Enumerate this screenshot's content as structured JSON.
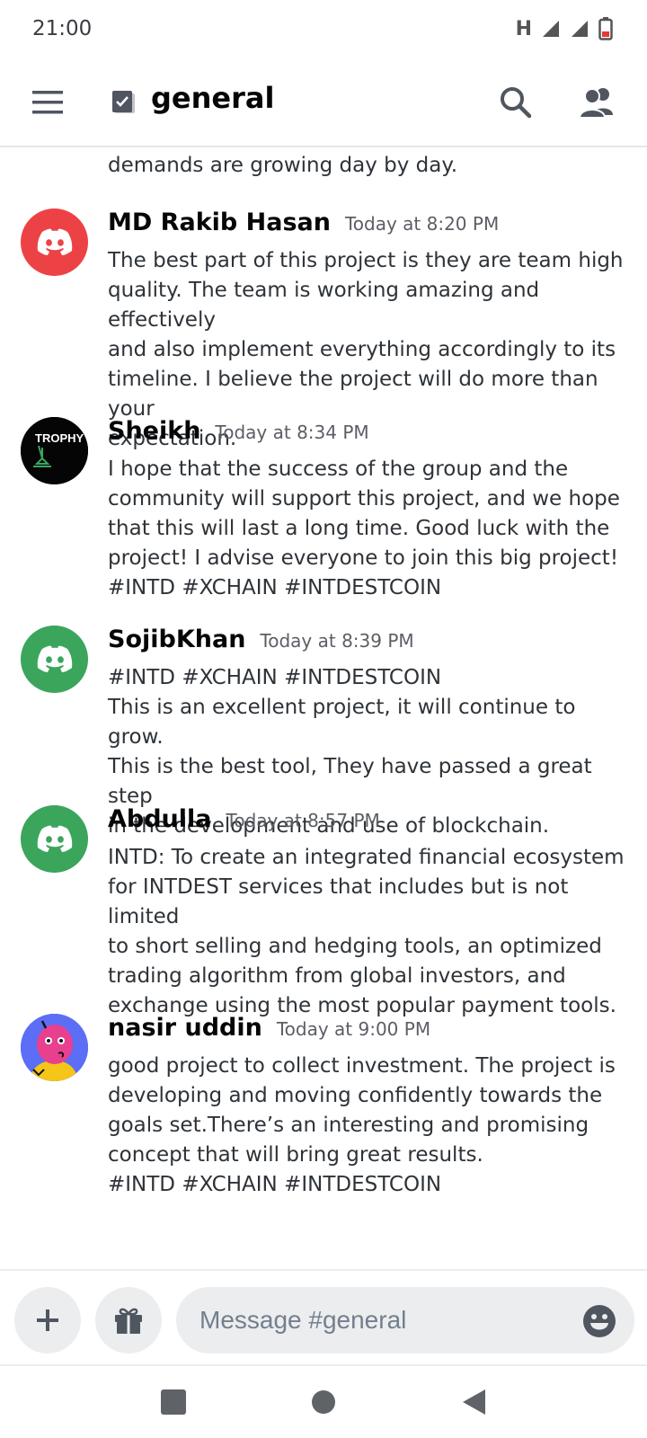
{
  "status_bar": {
    "time": "21:00",
    "network_type": "H"
  },
  "header": {
    "channel_name": "general",
    "icons": [
      "menu-icon",
      "channel-icon",
      "search-icon",
      "members-icon"
    ]
  },
  "messages": {
    "partial_text": "demands are growing day by day.",
    "items": [
      {
        "username": "MD Rakib Hasan",
        "timestamp": "Today at 8:20 PM",
        "avatar": "discord-default-red",
        "avatar_color": "#ed4245",
        "lines": [
          "The best part of this project is they are team high",
          "quality. The team is working amazing and effectively",
          "and also implement everything accordingly to its",
          "timeline. I believe the project will do more than your",
          "expectation."
        ]
      },
      {
        "username": "Sheikh",
        "timestamp": "Today at 8:34 PM",
        "avatar": "trophy-avatar",
        "avatar_text": "TROPHY",
        "lines": [
          "I hope that the success of the group and the",
          "community will support this project, and we hope",
          "that this will last a long time. Good luck with the",
          "project! I advise everyone to join this big project!",
          "#INTD #XCHAIN  #INTDESTCOIN"
        ]
      },
      {
        "username": "SojibKhan",
        "timestamp": "Today at 8:39 PM",
        "avatar": "discord-default-green",
        "avatar_color": "#3ba55c",
        "lines": [
          "#INTD #XCHAIN  #INTDESTCOIN",
          "This is an excellent project, it will continue to grow.",
          "This is the best tool, They have passed a great step",
          "in the development and use of blockchain."
        ]
      },
      {
        "username": "Abdulla",
        "timestamp": "Today at 8:57 PM",
        "avatar": "discord-default-green",
        "avatar_color": "#3ba55c",
        "lines": [
          "INTD: To create an integrated financial ecosystem",
          "for INTDEST services that includes but is not limited",
          "to short selling and hedging tools, an optimized",
          "trading algorithm from global investors, and",
          "exchange using the most popular payment tools."
        ]
      },
      {
        "username": "nasir uddin",
        "timestamp": "Today at 9:00 PM",
        "avatar": "cartoon-avatar",
        "lines": [
          "good project to collect investment. The project is",
          "developing and moving confidently towards the",
          "goals set.There’s an interesting and promising",
          "concept that will bring great results.",
          "#INTD #XCHAIN  #INTDESTCOIN"
        ]
      }
    ]
  },
  "input": {
    "placeholder": "Message #general"
  },
  "colors": {
    "accent": "#5865f2",
    "text": "#2e3338",
    "muted": "#5c5e66"
  }
}
